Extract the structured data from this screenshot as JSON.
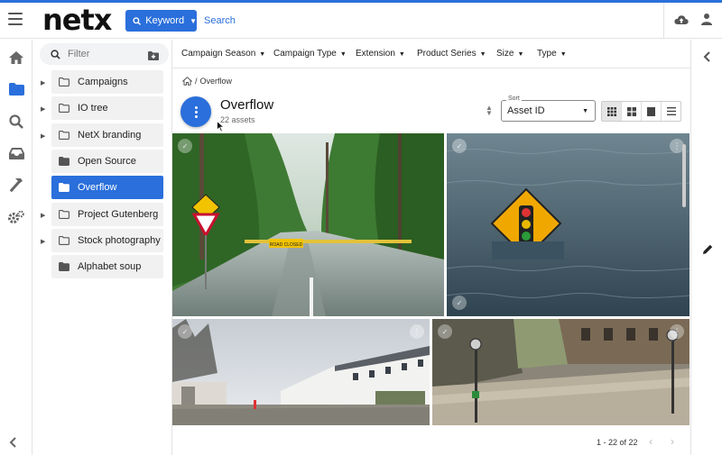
{
  "header": {
    "logo": "netx",
    "keyword_label": "Keyword",
    "search_label": "Search"
  },
  "filter": {
    "placeholder": "Filter"
  },
  "folders": [
    {
      "label": "Campaigns",
      "expandable": true,
      "active": false
    },
    {
      "label": "IO tree",
      "expandable": true,
      "active": false
    },
    {
      "label": "NetX branding",
      "expandable": true,
      "active": false
    },
    {
      "label": "Open Source",
      "expandable": false,
      "active": false
    },
    {
      "label": "Overflow",
      "expandable": false,
      "active": true
    },
    {
      "label": "Project Gutenberg",
      "expandable": true,
      "active": false
    },
    {
      "label": "Stock photography",
      "expandable": true,
      "active": false
    },
    {
      "label": "Alphabet soup",
      "expandable": false,
      "active": false
    }
  ],
  "toolbar": {
    "filters": [
      "Campaign Season",
      "Product Series",
      "Campaign Type",
      "Extension",
      "Size",
      "Type"
    ]
  },
  "breadcrumb": {
    "sep": "/",
    "current": "Overflow"
  },
  "page": {
    "title": "Overflow",
    "subtitle": "22 assets"
  },
  "sort": {
    "label": "Sort",
    "value": "Asset ID"
  },
  "pager": {
    "text": "1 - 22 of 22"
  },
  "colors": {
    "accent": "#2a6fdb"
  },
  "icons": [
    "hamburger-icon",
    "search-icon",
    "upload-cloud-icon",
    "user-icon",
    "home-icon",
    "folder-icon",
    "inbox-icon",
    "hammer-icon",
    "gear-icon",
    "chevron-left-icon",
    "pencil-icon"
  ]
}
